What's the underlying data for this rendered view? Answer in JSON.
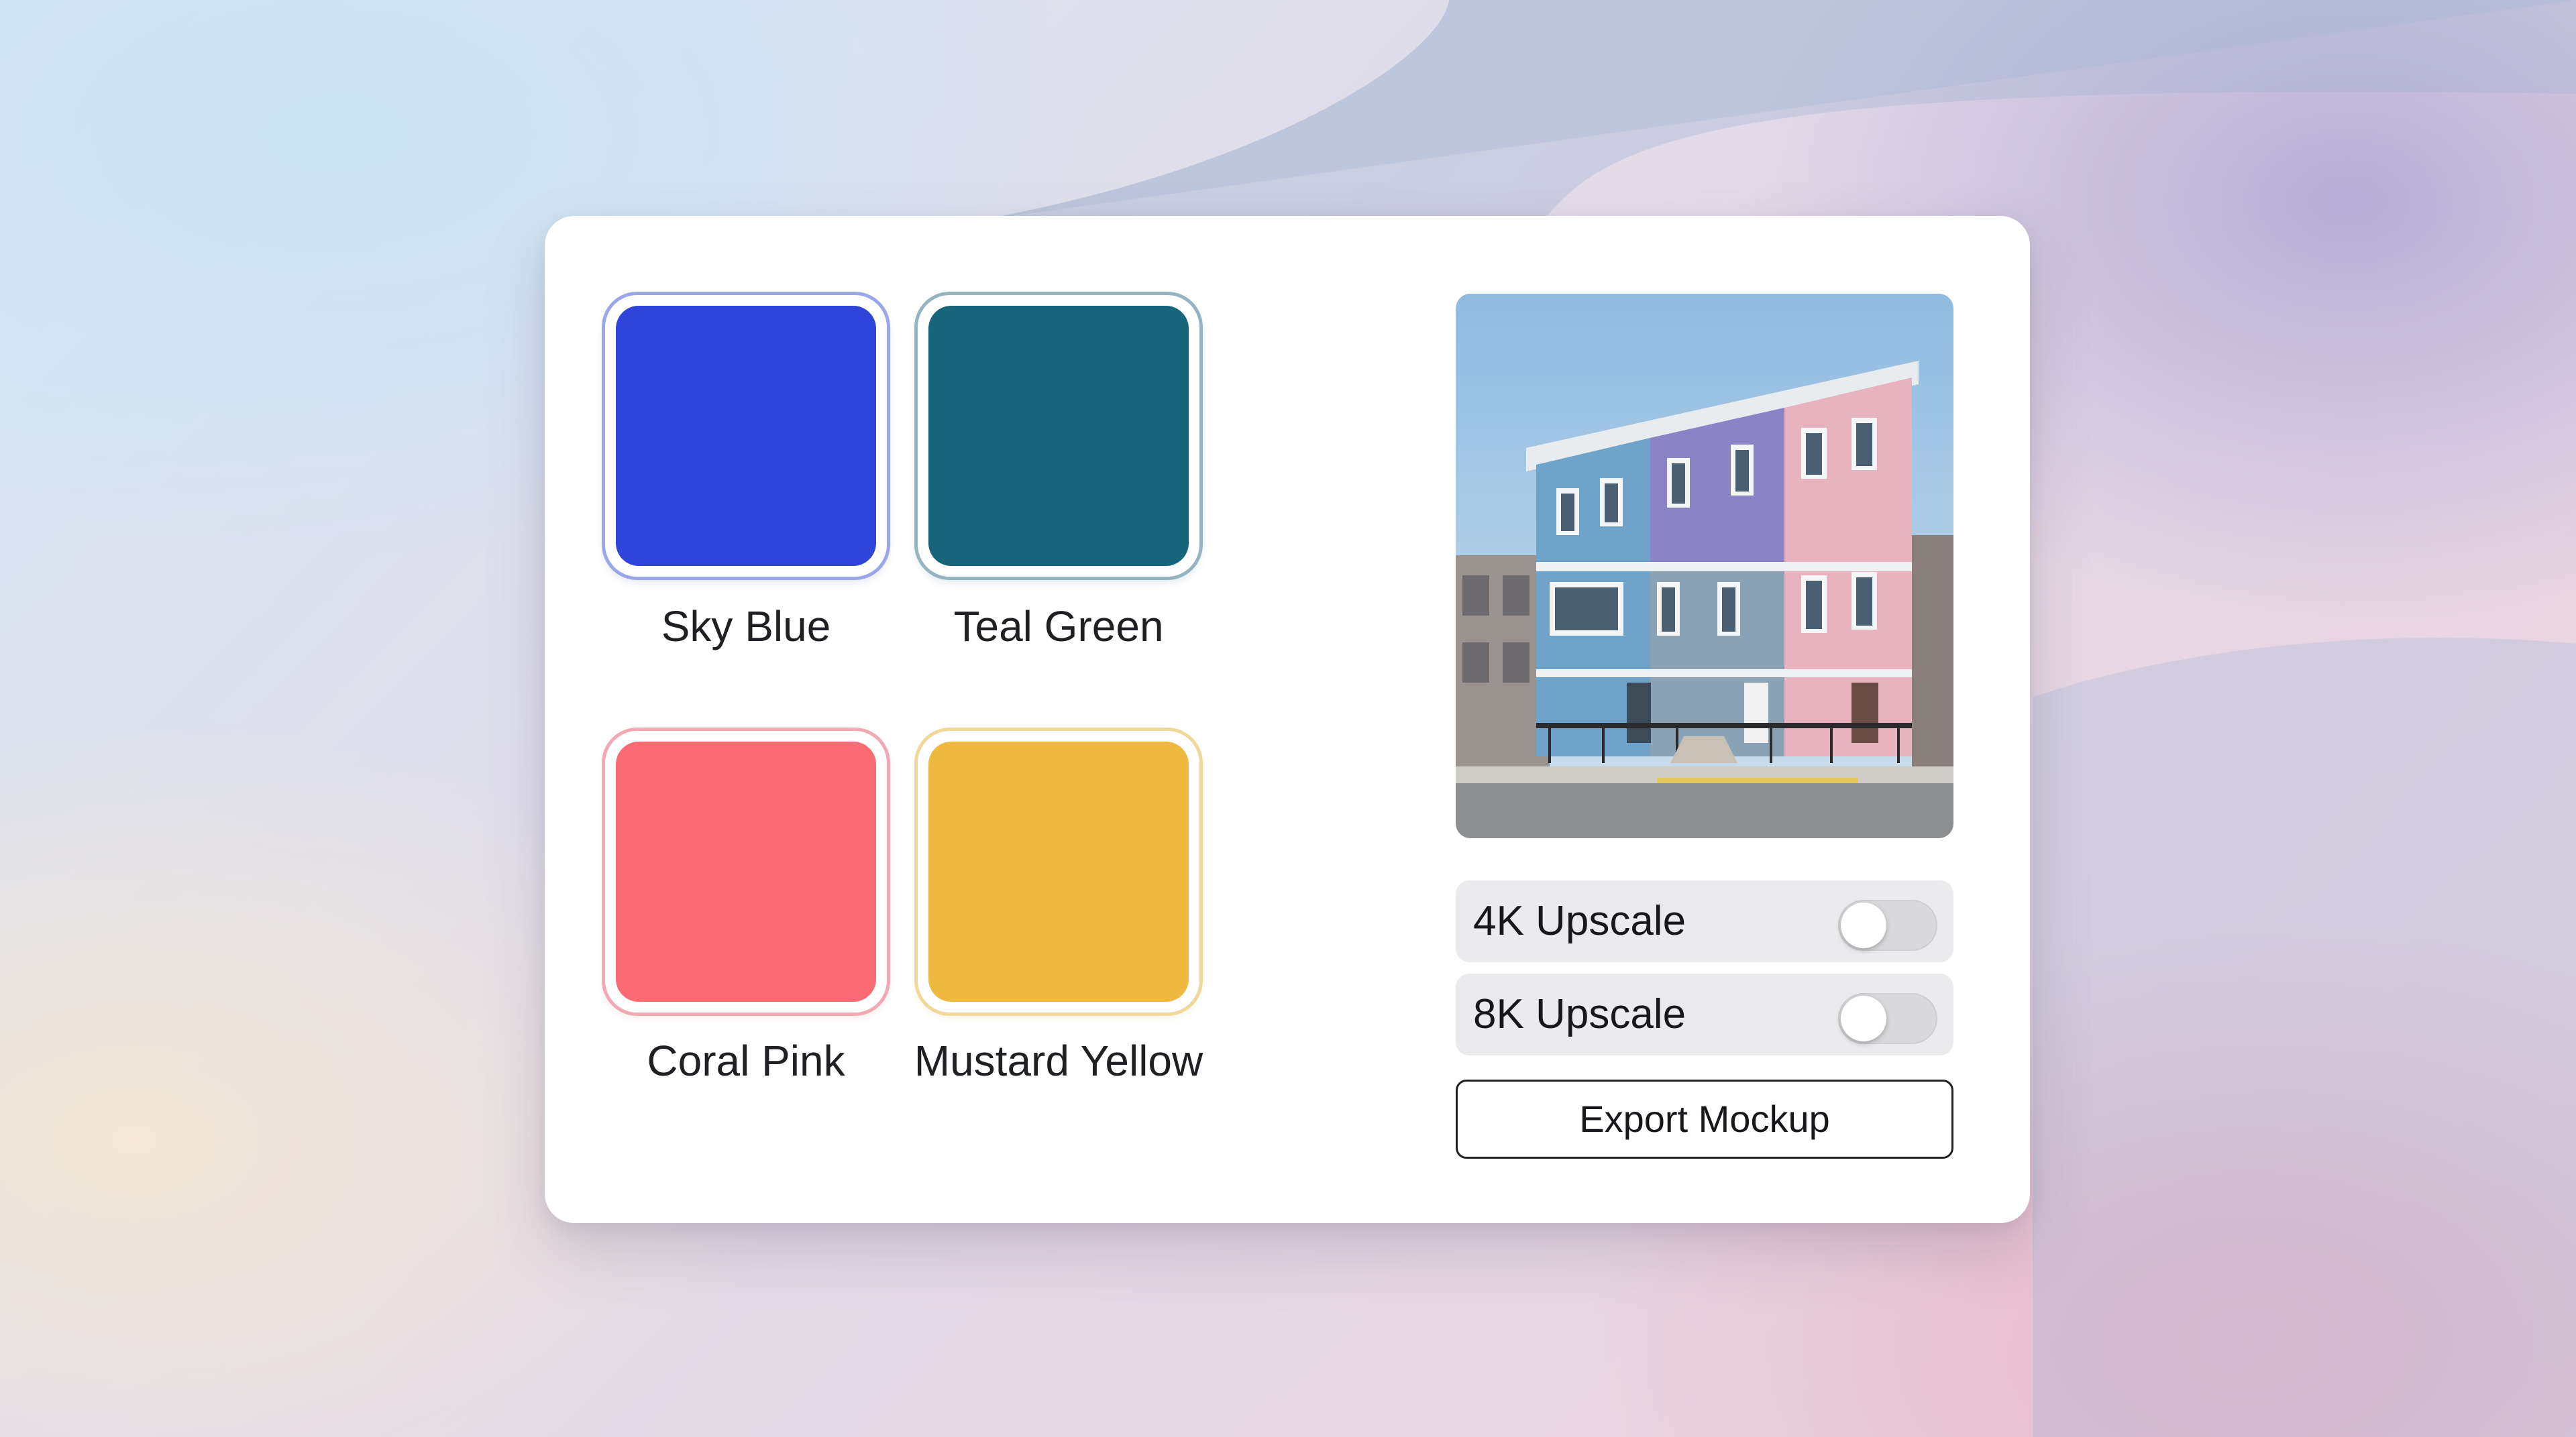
{
  "colors": {
    "sky_blue": "#2f44d9",
    "teal_green": "#17657b",
    "coral_pink": "#fb6b74",
    "mustard_yellow": "#efb940"
  },
  "swatches": [
    {
      "label": "Sky Blue",
      "fill": "#2f44d9",
      "ring": "#9aa6e8"
    },
    {
      "label": "Teal Green",
      "fill": "#17657b",
      "ring": "#93b4c0"
    },
    {
      "label": "Coral Pink",
      "fill": "#fb6b74",
      "ring": "#f2a9b4"
    },
    {
      "label": "Mustard Yellow",
      "fill": "#efb940",
      "ring": "#f1d89a"
    }
  ],
  "preview": {
    "icon": "house-preview-image"
  },
  "toggles": [
    {
      "label": "4K Upscale",
      "on": false
    },
    {
      "label": "8K Upscale",
      "on": false
    }
  ],
  "export_label": "Export Mockup"
}
